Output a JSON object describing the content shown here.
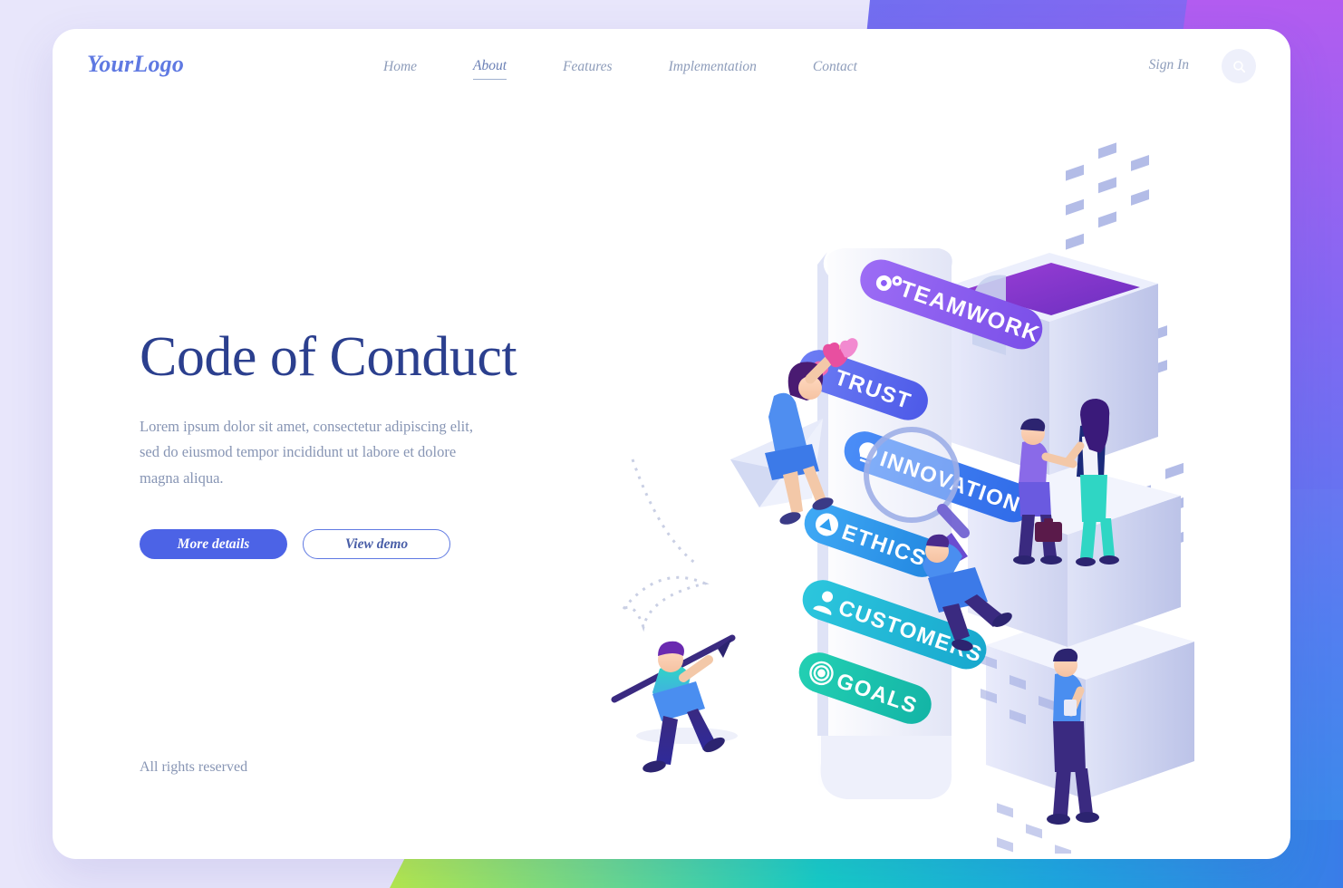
{
  "brand": {
    "logo": "YourLogo"
  },
  "nav": {
    "items": [
      {
        "label": "Home",
        "active": false
      },
      {
        "label": "About",
        "active": true
      },
      {
        "label": "Features",
        "active": false
      },
      {
        "label": "Implementation",
        "active": false
      },
      {
        "label": "Contact",
        "active": false
      }
    ],
    "sign_in": "Sign In",
    "search_icon": "search-icon"
  },
  "hero": {
    "title": "Code of Conduct",
    "subtitle": "Lorem ipsum dolor sit amet, consectetur adipiscing elit, sed do eiusmod tempor incididunt ut labore et dolore magna aliqua.",
    "primary_button": "More details",
    "secondary_button": "View demo",
    "rights": "All rights reserved"
  },
  "illustration": {
    "description": "isometric-office-building-with-scroll-of-values",
    "labels": [
      {
        "text": "TEAMWORK",
        "icon": "gears-icon",
        "color": "#8b5cf6"
      },
      {
        "text": "TRUST",
        "icon": "heart-icon",
        "color": "#5b6ef0"
      },
      {
        "text": "INNOVATION",
        "icon": "lightbulb-icon",
        "color": "#3b7ef5"
      },
      {
        "text": "ETHICS",
        "icon": "scales-icon",
        "color": "#2e9ef0"
      },
      {
        "text": "CUSTOMERS",
        "icon": "person-icon",
        "color": "#23bdda"
      },
      {
        "text": "GOALS",
        "icon": "target-icon",
        "color": "#1ec8b0"
      }
    ],
    "characters": [
      "woman-on-paper-plane-holding-heart",
      "man-climbing-with-magnifier",
      "man-carrying-arrow",
      "businessman-and-businesswoman-handshake",
      "man-with-coffee-cup"
    ]
  },
  "theme": {
    "accent_blue": "#4c63e6",
    "title_navy": "#2b3f8e",
    "muted_text": "#8795b4",
    "bg_lavender": "#e8e6fb",
    "gradient_purple": "#a05cf0",
    "gradient_blue": "#3f7df0",
    "gradient_green": "#a8e550",
    "gradient_teal": "#17c9c4"
  }
}
